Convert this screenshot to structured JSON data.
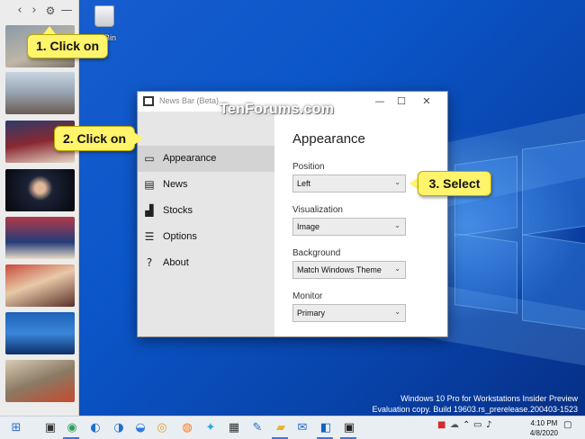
{
  "newsbar": {
    "back_icon": "chevron-left-icon",
    "forward_icon": "chevron-right-icon",
    "settings_icon": "gear-icon",
    "minimize_icon": "minimize-icon"
  },
  "desktop": {
    "recycle_bin_label": "Bin"
  },
  "window": {
    "title": "News Bar (Beta)",
    "watermark": "TenForums.com",
    "nav": [
      {
        "label": "Appearance",
        "icon": "monitor-icon"
      },
      {
        "label": "News",
        "icon": "news-icon"
      },
      {
        "label": "Stocks",
        "icon": "chart-icon"
      },
      {
        "label": "Options",
        "icon": "sliders-icon"
      },
      {
        "label": "About",
        "icon": "help-icon"
      }
    ],
    "content": {
      "title": "Appearance",
      "fields": [
        {
          "label": "Position",
          "value": "Left"
        },
        {
          "label": "Visualization",
          "value": "Image"
        },
        {
          "label": "Background",
          "value": "Match Windows Theme"
        },
        {
          "label": "Monitor",
          "value": "Primary"
        }
      ]
    }
  },
  "callouts": {
    "step1": "1. Click on",
    "step2": "2. Click on",
    "step3": "3. Select"
  },
  "build": {
    "line1": "Windows 10 Pro for Workstations Insider Preview",
    "line2": "Evaluation copy. Build 19603.rs_prerelease.200403-1523"
  },
  "taskbar": {
    "time": "4:10 PM",
    "date": "4/8/2020"
  },
  "colors": {
    "callout": "#fff46a",
    "accent": "#3b78d8",
    "sidenav_bg": "#e6e6e6"
  }
}
